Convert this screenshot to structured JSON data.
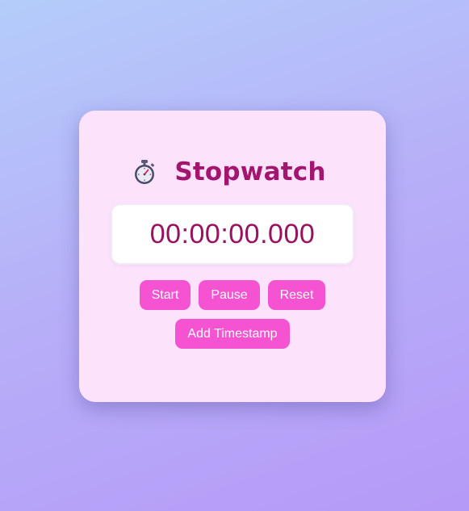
{
  "app": {
    "title": "Stopwatch",
    "icon": "stopwatch-icon"
  },
  "display": {
    "time": "00:00:00.000"
  },
  "controls": {
    "start_label": "Start",
    "pause_label": "Pause",
    "reset_label": "Reset",
    "add_timestamp_label": "Add Timestamp"
  },
  "colors": {
    "accent": "#f553d2",
    "title": "#a3166f",
    "time_text": "#99115f",
    "card_background": "#fce2fb"
  }
}
